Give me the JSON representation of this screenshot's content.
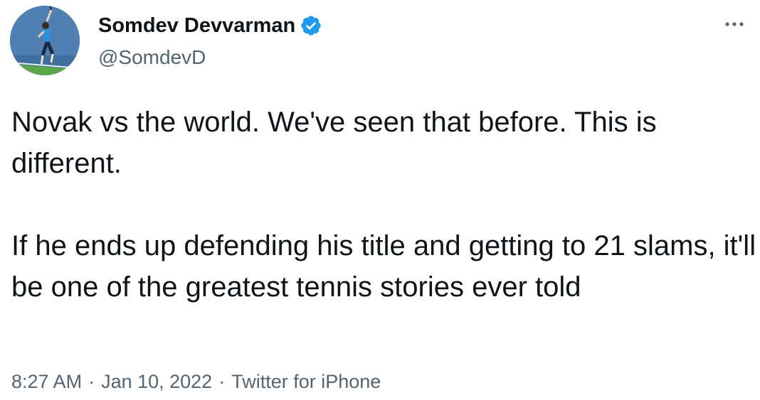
{
  "author": {
    "display_name": "Somdev Devvarman",
    "handle": "@SomdevD",
    "verified": true,
    "avatar_icon": "tennis-player-avatar"
  },
  "tweet": {
    "paragraph_1": "Novak vs the world. We've seen that before. This is different.",
    "paragraph_2": "If he ends up defending his title and getting to 21 slams, it'll be one of the greatest tennis stories ever told"
  },
  "meta": {
    "time": "8:27 AM",
    "date": "Jan 10, 2022",
    "source": "Twitter for iPhone",
    "separator": "·"
  },
  "colors": {
    "text_primary": "#0f1419",
    "text_secondary": "#536471",
    "verified_blue": "#1d9bf0"
  }
}
